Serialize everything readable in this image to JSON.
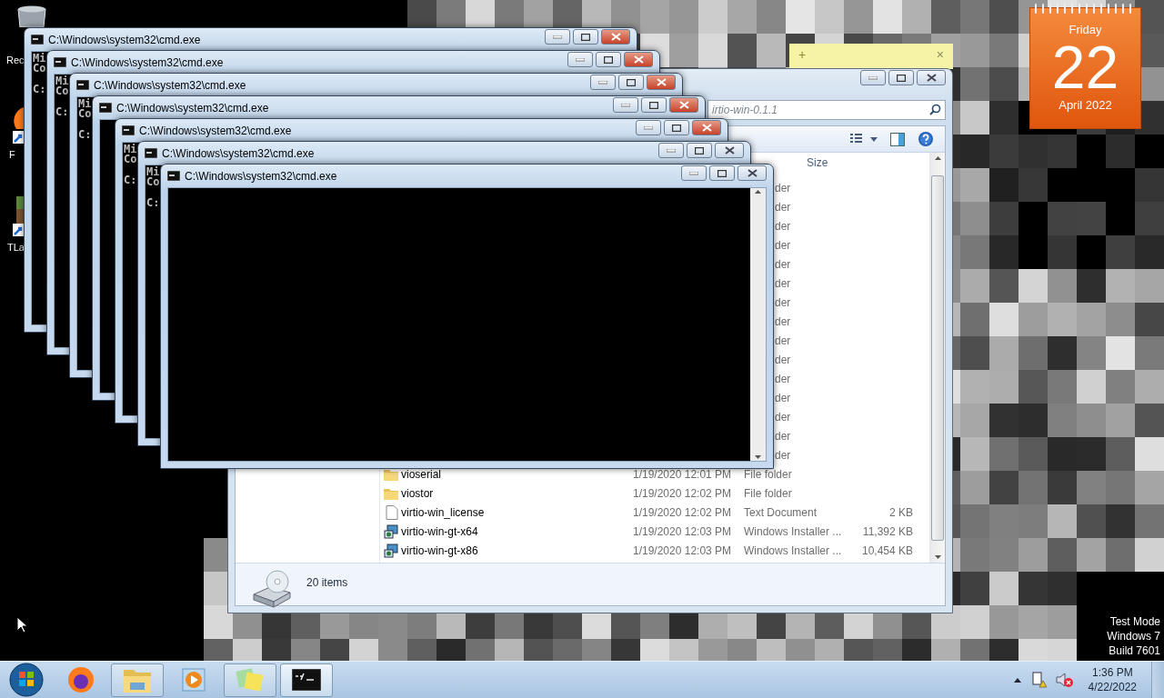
{
  "desktop": {
    "icons": [
      {
        "kind": "recycle",
        "label": "Rec"
      },
      {
        "kind": "firefox",
        "label": "F"
      },
      {
        "kind": "game",
        "label": "TLa"
      }
    ],
    "test_mode_lines": [
      "Test Mode",
      "Windows 7",
      "Build 7601"
    ]
  },
  "cmd_windows": [
    {
      "title": "C:\\Windows\\system32\\cmd.exe",
      "active": true,
      "banner": [
        "Mi",
        "Co"
      ],
      "prompt": "C:"
    },
    {
      "title": "C:\\Windows\\system32\\cmd.exe",
      "active": true,
      "banner": [
        "Mi",
        "Co"
      ],
      "prompt": "C:"
    },
    {
      "title": "C:\\Windows\\system32\\cmd.exe",
      "active": true,
      "banner": [
        "Mi",
        "Co"
      ],
      "prompt": "C:"
    },
    {
      "title": "C:\\Windows\\system32\\cmd.exe",
      "active": true
    },
    {
      "title": "C:\\Windows\\system32\\cmd.exe",
      "active": true,
      "banner": [
        "Mi",
        "Co"
      ],
      "prompt": "C:"
    },
    {
      "title": "C:\\Windows\\system32\\cmd.exe",
      "active": false,
      "banner": [
        "Mi",
        "Co"
      ],
      "prompt": "C:"
    },
    {
      "title": "C:\\Windows\\system32\\cmd.exe",
      "active": false
    }
  ],
  "explorer": {
    "search": {
      "placeholder": "irtio-win-0.1.1"
    },
    "size_header": "Size",
    "rows": [
      {
        "type": "der"
      },
      {
        "type": "der"
      },
      {
        "type": "der"
      },
      {
        "type": "der"
      },
      {
        "type": "der"
      },
      {
        "type": "der"
      },
      {
        "type": "der"
      },
      {
        "type": "der"
      },
      {
        "type": "der"
      },
      {
        "type": "der"
      },
      {
        "type": "der"
      },
      {
        "type": "der"
      },
      {
        "type": "der"
      },
      {
        "type": "der"
      },
      {
        "type": "der"
      },
      {
        "kind": "folder",
        "name": "vioserial",
        "date": "1/19/2020 12:01 PM",
        "type": "File folder"
      },
      {
        "kind": "folder",
        "name": "viostor",
        "date": "1/19/2020 12:02 PM",
        "type": "File folder"
      },
      {
        "kind": "text",
        "name": "virtio-win_license",
        "date": "1/19/2020 12:02 PM",
        "type": "Text Document",
        "size": "2 KB"
      },
      {
        "kind": "installer",
        "name": "virtio-win-gt-x64",
        "date": "1/19/2020 12:03 PM",
        "type": "Windows Installer ...",
        "size": "11,392 KB"
      },
      {
        "kind": "installer",
        "name": "virtio-win-gt-x86",
        "date": "1/19/2020 12:03 PM",
        "type": "Windows Installer ...",
        "size": "10,454 KB"
      }
    ],
    "status": "20 items"
  },
  "sticky_note": {
    "add": "+",
    "close": "×"
  },
  "calendar": {
    "day_name": "Friday",
    "day": "22",
    "month_year": "April 2022"
  },
  "taskbar": {
    "apps": [
      {
        "kind": "firefox",
        "open": false,
        "active": false
      },
      {
        "kind": "explorer",
        "open": true,
        "active": false
      },
      {
        "kind": "media",
        "open": false,
        "active": false
      },
      {
        "kind": "sticky",
        "open": true,
        "active": false
      },
      {
        "kind": "cmd",
        "open": true,
        "active": true
      }
    ],
    "time": "1:36 PM",
    "date": "4/22/2022"
  }
}
